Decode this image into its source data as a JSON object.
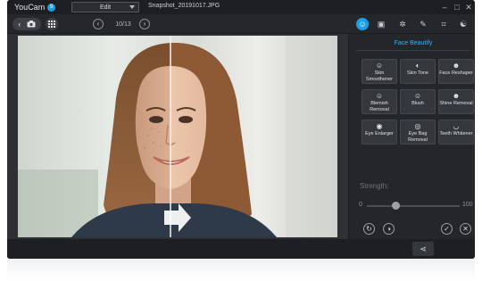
{
  "app": {
    "name": "YouCam",
    "version_badge": "9"
  },
  "titlebar": {
    "mode": "Edit",
    "filename": "Snapshot_20191017.JPG"
  },
  "toolbar": {
    "counter": "10/13",
    "prev_icon": "‹",
    "next_icon": "›"
  },
  "panel": {
    "title": "Face Beautify",
    "features": [
      {
        "label": "Skin Smoothener",
        "icon": "skin-smoothener-icon",
        "glyph": "☺"
      },
      {
        "label": "Skin Tone",
        "icon": "skin-tone-icon",
        "glyph": "◐"
      },
      {
        "label": "Face Reshaper",
        "icon": "face-reshaper-icon",
        "glyph": "☻"
      },
      {
        "label": "Blemish Removal",
        "icon": "blemish-removal-icon",
        "glyph": "☺"
      },
      {
        "label": "Blush",
        "icon": "blush-icon",
        "glyph": "☺"
      },
      {
        "label": "Shine Removal",
        "icon": "shine-removal-icon",
        "glyph": "☻"
      },
      {
        "label": "Eye Enlarger",
        "icon": "eye-enlarger-icon",
        "glyph": "◉"
      },
      {
        "label": "Eye Bag Removal",
        "icon": "eye-bag-removal-icon",
        "glyph": "◎"
      },
      {
        "label": "Teeth Whitener",
        "icon": "teeth-whitener-icon",
        "glyph": "◡"
      }
    ],
    "strength_label": "Strength:",
    "slider": {
      "min": "0",
      "max": "100",
      "value": 0.31
    }
  },
  "colors": {
    "accent": "#1aa0e6",
    "panel_bg": "#24262a",
    "title_blue": "#3ab0f0"
  }
}
